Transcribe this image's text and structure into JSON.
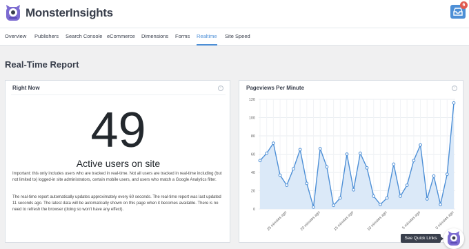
{
  "header": {
    "logo_text": "MonsterInsights",
    "notification_count": "6"
  },
  "nav": {
    "tabs": [
      {
        "label": "Overview",
        "active": false
      },
      {
        "label": "Publishers",
        "active": false
      },
      {
        "label": "Search Console",
        "active": false
      },
      {
        "label": "eCommerce",
        "active": false
      },
      {
        "label": "Dimensions",
        "active": false
      },
      {
        "label": "Forms",
        "active": false
      },
      {
        "label": "Realtime",
        "active": true
      },
      {
        "label": "Site Speed",
        "active": false
      }
    ]
  },
  "page": {
    "title": "Real-Time Report"
  },
  "right_now": {
    "title": "Right Now",
    "active_users": "49",
    "active_label": "Active users on site",
    "note_1": "Important: this only includes users who are tracked in real-time. Not all users are tracked in real-time including (but not limited to) logged-in site administrators, certain mobile users, and users who match a Google Analytics filter.",
    "note_2": "The real-time report automatically updates approximately every 60 seconds. The real-time report was last updated 11 seconds ago. The latest data will be automatically shown on this page when it becomes available. There is no need to refresh the browser (doing so won't have any effect)."
  },
  "pageviews": {
    "title": "Pageviews Per Minute"
  },
  "chart_data": {
    "type": "area",
    "title": "Pageviews Per Minute",
    "ylim": [
      0,
      120
    ],
    "yticks": [
      0,
      20,
      40,
      60,
      80,
      100,
      120
    ],
    "x_tick_labels": [
      "25 minutes ago",
      "20 minutes ago",
      "15 minutes ago",
      "10 minutes ago",
      "5 minutes ago",
      "0 minutes ago"
    ],
    "x_tick_index": [
      4,
      9,
      14,
      19,
      24,
      29
    ],
    "grid": true,
    "values": [
      53,
      61,
      72,
      37,
      26,
      44,
      65,
      28,
      2,
      66,
      46,
      4,
      12,
      60,
      21,
      61,
      45,
      14,
      5,
      12,
      49,
      14,
      26,
      53,
      70,
      11,
      36,
      5,
      38,
      116
    ],
    "series_color": "#4d8fd6",
    "fill_color": "#dbe9f8"
  },
  "footer": {
    "quick_links_label": "See Quick Links"
  },
  "colors": {
    "accent": "#4d8fd6",
    "badge": "#e15a4f",
    "text_dark": "#393f4c"
  }
}
